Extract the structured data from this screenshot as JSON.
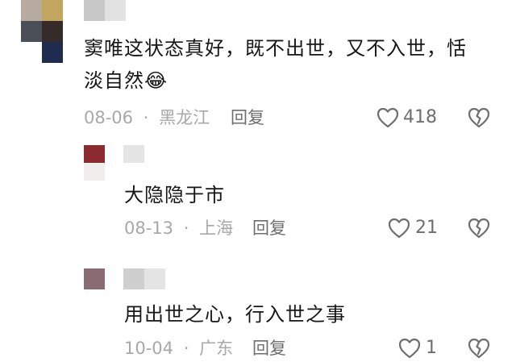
{
  "comments": [
    {
      "text_line1": "窦唯这状态真好，既不出世，又不入世，恬",
      "text_line2": "淡自然",
      "emoji": "😂",
      "date": "08-06",
      "location": "黑龙江",
      "reply_label": "回复",
      "like_count": "418"
    },
    {
      "text": "大隐隐于市",
      "date": "08-13",
      "location": "上海",
      "reply_label": "回复",
      "like_count": "21"
    },
    {
      "text": "用出世之心，行入世之事",
      "date": "10-04",
      "location": "广东",
      "reply_label": "回复",
      "like_count": "1"
    }
  ],
  "separator": "·",
  "colors": {
    "text": "#161616",
    "meta": "#a8a8a8",
    "icon": "#6e6e6e"
  },
  "icons": {
    "like": "heart-outline-icon",
    "dislike": "broken-heart-icon"
  }
}
